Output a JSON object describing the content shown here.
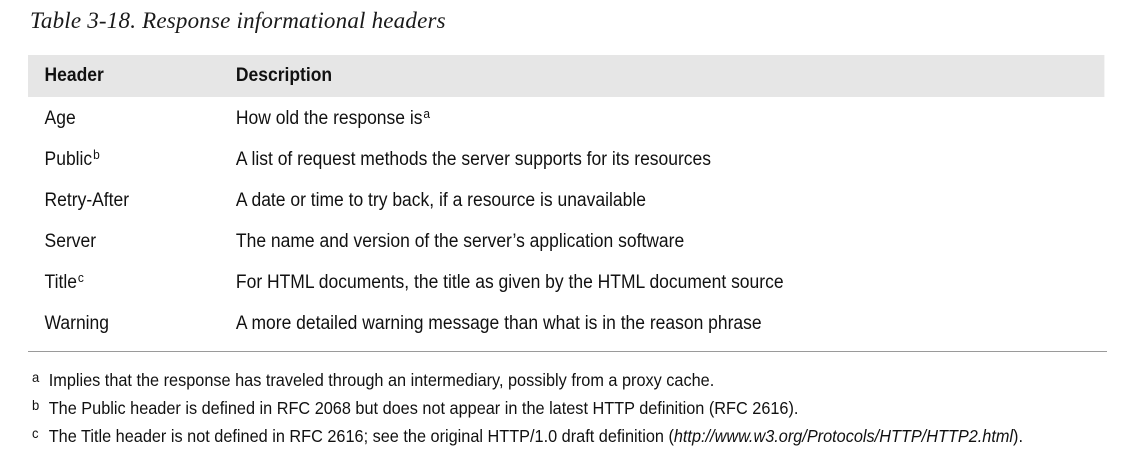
{
  "caption": "Table 3-18. Response informational headers",
  "table": {
    "columns": [
      "Header",
      "Description"
    ],
    "rows": [
      {
        "header": "Age",
        "header_note": "",
        "description": "How old the response is",
        "description_note": "a"
      },
      {
        "header": "Public",
        "header_note": "b",
        "description": "A list of request methods the server supports for its resources",
        "description_note": ""
      },
      {
        "header": "Retry-After",
        "header_note": "",
        "description": "A date or time to try back, if a resource is unavailable",
        "description_note": ""
      },
      {
        "header": "Server",
        "header_note": "",
        "description": "The name and version of the server’s application software",
        "description_note": ""
      },
      {
        "header": "Title",
        "header_note": "c",
        "description": "For HTML documents, the title as given by the HTML document source",
        "description_note": ""
      },
      {
        "header": "Warning",
        "header_note": "",
        "description": "A more detailed warning message than what is in the reason phrase",
        "description_note": ""
      }
    ]
  },
  "footnotes": [
    {
      "mark": "a",
      "text": "Implies that the response has traveled through an intermediary, possibly from a proxy cache.",
      "url": "",
      "after": ""
    },
    {
      "mark": "b",
      "text": "The Public header is defined in RFC 2068 but does not appear in the latest HTTP definition (RFC 2616).",
      "url": "",
      "after": ""
    },
    {
      "mark": "c",
      "text": "The Title header is not defined in RFC 2616; see the original HTTP/1.0 draft definition (",
      "url": "http://www.w3.org/Protocols/HTTP/HTTP2.html",
      "after": ")."
    }
  ]
}
